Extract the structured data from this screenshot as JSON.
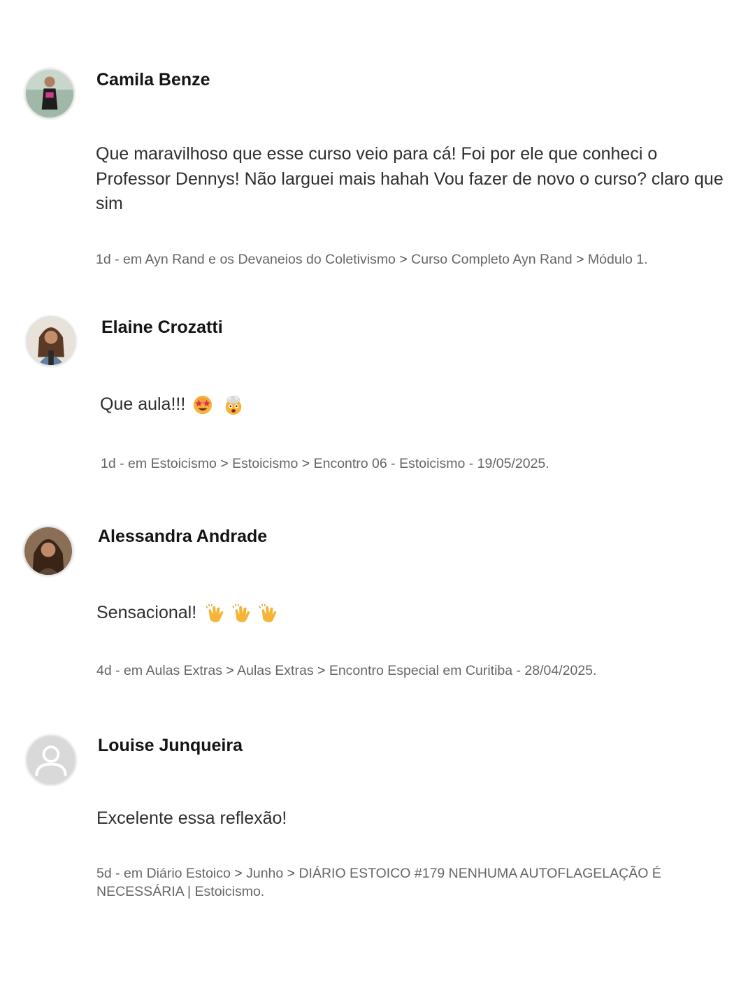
{
  "comments": [
    {
      "author": "Camila Benze",
      "text": "Que maravilhoso que esse curso veio para cá! Foi por ele que conheci o Professor Dennys! Não larguei mais hahah Vou fazer de novo o curso? claro que sim",
      "age": "1d",
      "in": "em",
      "crumbs": [
        "Ayn Rand e os Devaneios do Coletivismo",
        "Curso Completo Ayn Rand",
        "Módulo 1."
      ]
    },
    {
      "author": "Elaine Crozatti",
      "text": "Que aula!!!",
      "emojis": [
        "star-struck-emoji",
        "exploding-head-emoji"
      ],
      "age": "1d",
      "in": "em",
      "crumbs": [
        "Estoicismo",
        "Estoicismo",
        "Encontro 06 - Estoicismo - 19/05/2025."
      ]
    },
    {
      "author": "Alessandra Andrade",
      "text": "Sensacional!",
      "emojis": [
        "clapping-hands-emoji",
        "clapping-hands-emoji",
        "clapping-hands-emoji"
      ],
      "age": "4d",
      "in": "em",
      "crumbs": [
        "Aulas Extras",
        "Aulas Extras",
        "Encontro Especial em Curitiba - 28/04/2025."
      ]
    },
    {
      "author": "Louise Junqueira",
      "text": "Excelente essa reflexão!",
      "age": "5d",
      "in": "em",
      "crumbs": [
        "Diário Estoico",
        "Junho",
        "DIÁRIO ESTOICO #179 NENHUMA AUTOFLAGELAÇÃO É NECESSÁRIA | Estoicismo."
      ]
    }
  ],
  "separator": ">",
  "meta_dash": "-"
}
